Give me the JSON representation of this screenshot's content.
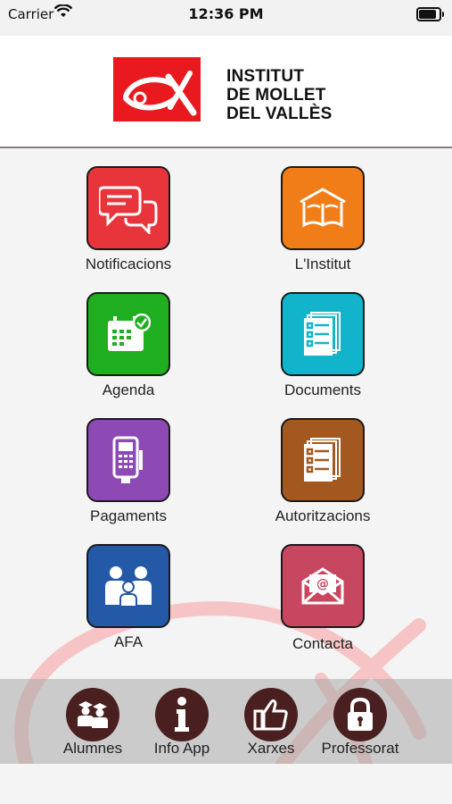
{
  "status_bar": {
    "carrier": "Carrier",
    "time": "12:36 PM"
  },
  "header": {
    "school_name_lines": [
      "INSTITUT",
      "DE MOLLET",
      "DEL VALLÈS"
    ]
  },
  "tiles": [
    {
      "label": "Notificacions",
      "icon": "chat-bubbles-icon",
      "color": "#e8343b"
    },
    {
      "label": "L'Institut",
      "icon": "school-book-icon",
      "color": "#f07d17"
    },
    {
      "label": "Agenda",
      "icon": "calendar-check-icon",
      "color": "#1fae1f"
    },
    {
      "label": "Documents",
      "icon": "documents-checklist-icon",
      "color": "#12b4cc"
    },
    {
      "label": "Pagaments",
      "icon": "card-terminal-icon",
      "color": "#8e4ab4"
    },
    {
      "label": "Autoritzacions",
      "icon": "authorization-checklist-icon",
      "color": "#a3581f"
    },
    {
      "label": "AFA",
      "icon": "family-icon",
      "color": "#2459a8"
    },
    {
      "label": "Contacta",
      "icon": "email-envelope-icon",
      "color": "#c74660"
    }
  ],
  "bottom_nav": [
    {
      "label": "Alumnes",
      "icon": "students-icon"
    },
    {
      "label": "Info App",
      "icon": "info-icon"
    },
    {
      "label": "Xarxes",
      "icon": "thumbs-up-icon"
    },
    {
      "label": "Professorat",
      "icon": "padlock-icon"
    }
  ],
  "colors": {
    "header_bg": "#ffffff",
    "bottom_circle": "#4a1f1f",
    "fish_watermark": "#f4b8b8",
    "brand_red": "#e8191f"
  }
}
